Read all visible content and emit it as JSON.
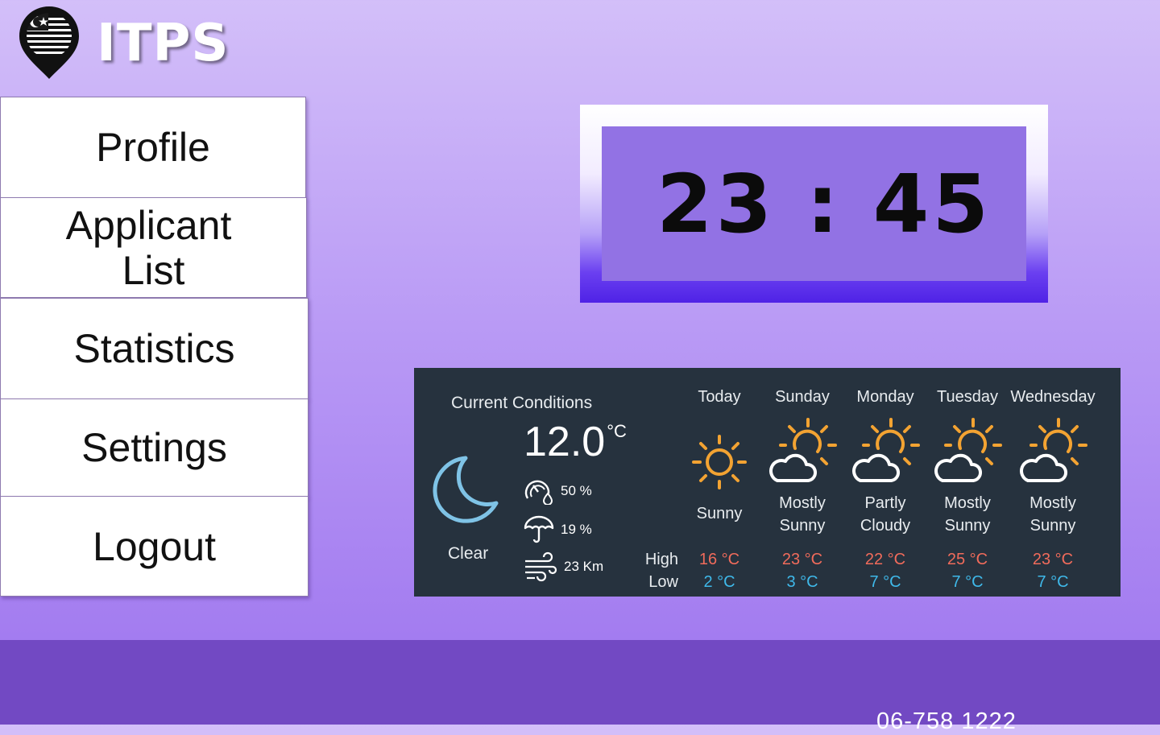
{
  "app": {
    "title": "ITPS"
  },
  "logo": {
    "icon": "malaysia-flag-map-pin"
  },
  "menu": {
    "items": [
      {
        "id": "profile",
        "label": "Profile"
      },
      {
        "id": "applicant-list",
        "label_line1": "Applicant",
        "label_line2": "List"
      },
      {
        "id": "statistics",
        "label": "Statistics"
      },
      {
        "id": "settings",
        "label": "Settings"
      },
      {
        "id": "logout",
        "label": "Logout"
      }
    ]
  },
  "clock": {
    "time": "23 : 45"
  },
  "weather": {
    "current": {
      "title": "Current Conditions",
      "temperature": "12.0",
      "unit": "°C",
      "condition": "Clear",
      "icon": "moon-icon",
      "humidity": "50 %",
      "precipitation": "19 %",
      "wind": "23 Km"
    },
    "labels": {
      "high": "High",
      "low": "Low"
    },
    "forecast": [
      {
        "day": "Today",
        "cond1": "Sunny",
        "cond2": "",
        "icon": "sun-icon",
        "high": "16 °C",
        "low": "2 °C"
      },
      {
        "day": "Sunday",
        "cond1": "Mostly",
        "cond2": "Sunny",
        "icon": "sun-cloud-icon",
        "high": "23 °C",
        "low": "3 °C"
      },
      {
        "day": "Monday",
        "cond1": "Partly",
        "cond2": "Cloudy",
        "icon": "sun-cloud-icon",
        "high": "22 °C",
        "low": "7 °C"
      },
      {
        "day": "Tuesday",
        "cond1": "Mostly",
        "cond2": "Sunny",
        "icon": "sun-cloud-icon",
        "high": "25 °C",
        "low": "7 °C"
      },
      {
        "day": "Wednesday",
        "cond1": "Mostly",
        "cond2": "Sunny",
        "icon": "sun-cloud-icon",
        "high": "23 °C",
        "low": "7 °C"
      }
    ],
    "colors": {
      "high": "#f06b5b",
      "low": "#3fb9ea",
      "sun": "#f3a332",
      "moon": "#7fc3e6",
      "panel": "#26323e"
    }
  },
  "footer": {
    "phone": "06-758 1222"
  },
  "colors": {
    "footer": "#7249c3",
    "clock_face": "#9272e4"
  }
}
